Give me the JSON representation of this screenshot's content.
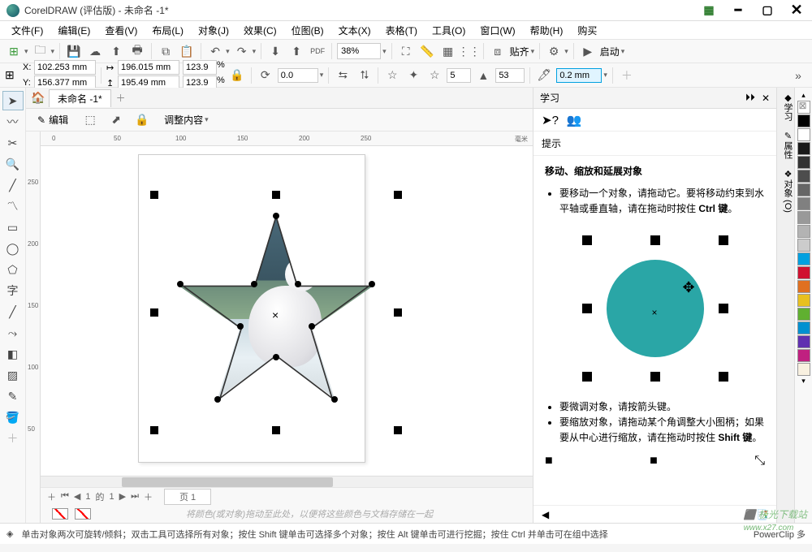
{
  "title": "CorelDRAW (评估版) - 未命名 -1*",
  "menu": [
    "文件(F)",
    "编辑(E)",
    "查看(V)",
    "布局(L)",
    "对象(J)",
    "效果(C)",
    "位图(B)",
    "文本(X)",
    "表格(T)",
    "工具(O)",
    "窗口(W)",
    "帮助(H)",
    "购买"
  ],
  "zoom": "38%",
  "align_label": "贴齐",
  "launch_label": "启动",
  "prop": {
    "x": "102.253 mm",
    "y": "156.377 mm",
    "w": "196.015 mm",
    "h": "195.49 mm",
    "sx": "123.9",
    "sy": "123.9",
    "pct_unit": "%",
    "angle": "0.0",
    "star_points": "5",
    "star_sharp": "53",
    "outline": "0.2 mm"
  },
  "doc_tab": "未命名 -1*",
  "ruler_unit": "毫米",
  "ruler_h": [
    "0",
    "50",
    "100",
    "150",
    "200",
    "250"
  ],
  "ruler_v": [
    "250",
    "200",
    "150",
    "100",
    "50"
  ],
  "ctx": {
    "edit": "编辑",
    "adjust": "调整内容"
  },
  "page_nav": {
    "count_prefix": "1",
    "count_of": "的",
    "count_total": "1",
    "page_lbl": "页 1"
  },
  "hint": "将颜色(或对象)拖动至此处，以便将这些颜色与文档存储在一起",
  "learn": {
    "tab": "学习",
    "hints_label": "提示",
    "heading": "移动、缩放和延展对象",
    "li1a": "要移动一个对象，请拖动它。要将移动约束到水平轴或垂直轴，请在拖动时按住 ",
    "li1b": "Ctrl 键",
    "li1c": "。",
    "li2": "要微调对象，请按箭头键。",
    "li3a": "要缩放对象，请拖动某个角调整大小图柄；如果要从中心进行缩放，请在拖动时按住 ",
    "li3b": "Shift 键",
    "li3c": "。"
  },
  "side_tabs": [
    "学习",
    "属性",
    "对象 (O)"
  ],
  "swatches": [
    "#000000",
    "#FFFFFF",
    "#1a1a1a",
    "#333333",
    "#4d4d4d",
    "#666666",
    "#808080",
    "#999999",
    "#b3b3b3",
    "#cccccc",
    "#00a0e0",
    "#d01030",
    "#e07020",
    "#e8c020",
    "#60b030",
    "#0090d0",
    "#6030b0",
    "#c02080",
    "#f8f0e0"
  ],
  "status": "单击对象两次可旋转/倾斜；双击工具可选择所有对象；按住 Shift 键单击可选择多个对象；按住 Alt 键单击可进行挖掘；按住 Ctrl 并单击可在组中选择",
  "status_right": "PowerClip 多",
  "watermark1": "极光下载站",
  "watermark2": "www.x27.com"
}
